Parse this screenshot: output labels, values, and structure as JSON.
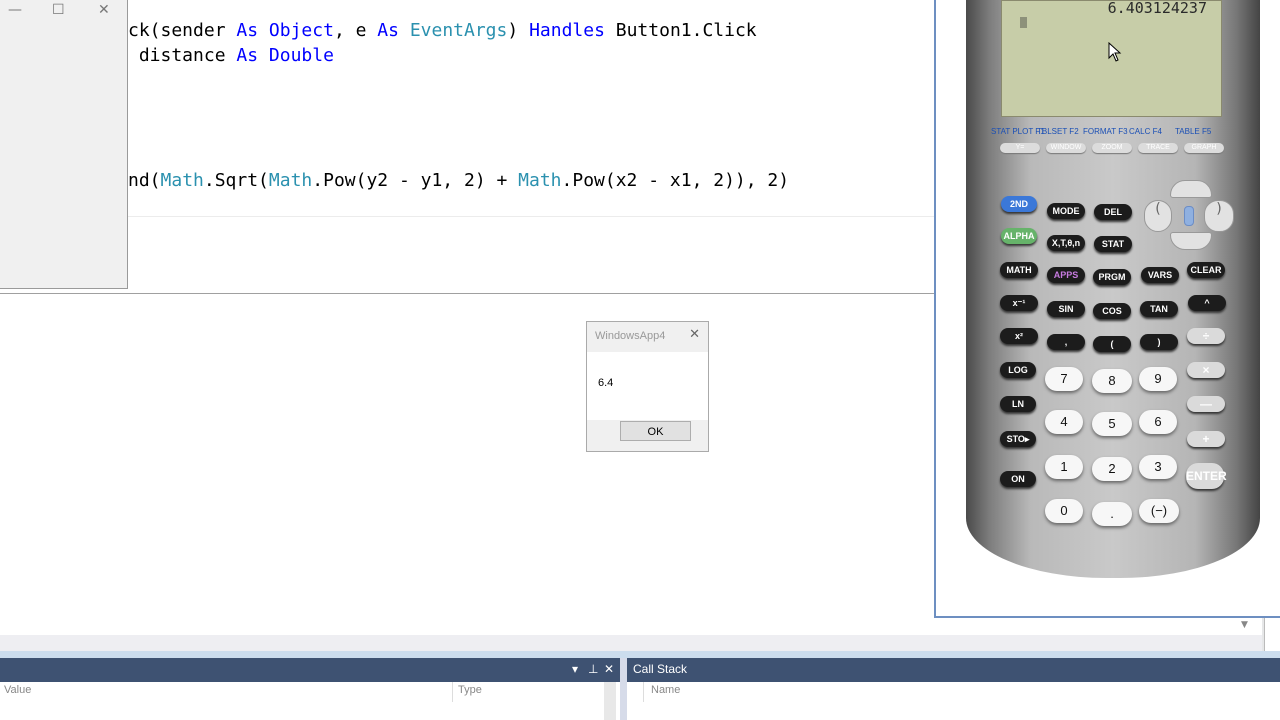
{
  "code_editor": {
    "lines": [
      {
        "parts": [
          [
            "ck(sender ",
            ""
          ],
          [
            "As",
            "kw"
          ],
          [
            " ",
            ""
          ],
          [
            "Object",
            "kw"
          ],
          [
            ", e ",
            ""
          ],
          [
            "As",
            "kw"
          ],
          [
            " ",
            ""
          ],
          [
            "EventArgs",
            "ty"
          ],
          [
            ") ",
            ""
          ],
          [
            "Handles",
            "kw"
          ],
          [
            " Button1.Click",
            ""
          ]
        ]
      },
      {
        "parts": [
          [
            " distance ",
            ""
          ],
          [
            "As",
            "kw"
          ],
          [
            " ",
            ""
          ],
          [
            "Double",
            "kw"
          ]
        ]
      },
      {
        "parts": [
          [
            "nd(",
            ""
          ],
          [
            "Math",
            "ty"
          ],
          [
            ".Sqrt(",
            ""
          ],
          [
            "Math",
            "ty"
          ],
          [
            ".Pow(y2 - y1, 2) + ",
            ""
          ],
          [
            "Math",
            "ty"
          ],
          [
            ".Pow(x2 - x1, 2)), 2)",
            ""
          ]
        ]
      }
    ]
  },
  "form_window": {
    "minimize": "—",
    "maximize": "☐",
    "close": "✕"
  },
  "message_box": {
    "title": "WindowsApp4",
    "close": "✕",
    "message": "6.4",
    "ok_label": "OK"
  },
  "locals_pane": {
    "col_value": "Value",
    "col_type": "Type",
    "ctl_dropdown": "▾",
    "ctl_pin": "⊥",
    "ctl_close": "✕"
  },
  "callstack_pane": {
    "title": "Call Stack",
    "col_name": "Name"
  },
  "calculator": {
    "display_value": "6.403124237",
    "function_labels": [
      "STAT PLOT F1",
      "TBLSET F2",
      "FORMAT F3",
      "CALC F4",
      "TABLE F5"
    ],
    "function_keys": [
      "Y=",
      "WINDOW",
      "ZOOM",
      "TRACE",
      "GRAPH"
    ],
    "keys": {
      "2nd": "2ND",
      "mode": "MODE",
      "del": "DEL",
      "alpha": "ALPHA",
      "xt": "X,T,θ,n",
      "stat": "STAT",
      "math": "MATH",
      "apps": "APPS",
      "prgm": "PRGM",
      "vars": "VARS",
      "clear": "CLEAR",
      "xinv": "x⁻¹",
      "sin": "SIN",
      "cos": "COS",
      "tan": "TAN",
      "pow": "^",
      "xsq": "x²",
      "comma": ",",
      "lpar": "(",
      "rpar": ")",
      "div": "÷",
      "log": "LOG",
      "k7": "7",
      "k8": "8",
      "k9": "9",
      "mul": "×",
      "ln": "LN",
      "k4": "4",
      "k5": "5",
      "k6": "6",
      "sub": "—",
      "sto": "STO▸",
      "k1": "1",
      "k2": "2",
      "k3": "3",
      "add": "+",
      "on": "ON",
      "k0": "0",
      "dot": ".",
      "neg": "(−)",
      "enter": "ENTER"
    }
  },
  "colors": {
    "accent_blue": "#3b78d8",
    "panel_header": "#3e5272",
    "keyword": "#0000ff",
    "type_name": "#2b91af"
  }
}
